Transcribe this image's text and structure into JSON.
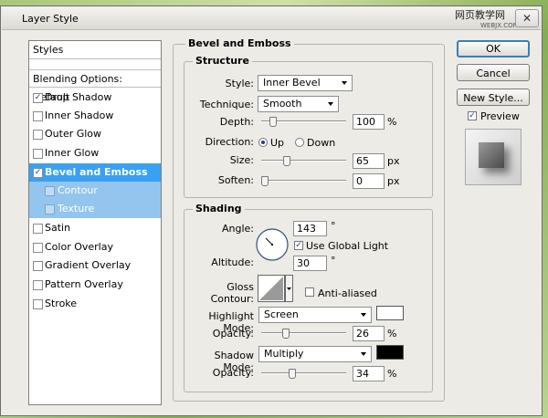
{
  "window": {
    "title": "Layer Style",
    "close_glyph": "✕",
    "watermark": "网页教学网",
    "watermark_url": "WEBJX.COM"
  },
  "styles_list": {
    "header": "Styles",
    "blending": "Blending Options: Default",
    "items": [
      {
        "label": "Drop Shadow",
        "checked": "✓"
      },
      {
        "label": "Inner Shadow",
        "checked": ""
      },
      {
        "label": "Outer Glow",
        "checked": ""
      },
      {
        "label": "Inner Glow",
        "checked": ""
      },
      {
        "label": "Bevel and Emboss",
        "checked": "✓"
      },
      {
        "label": "Contour",
        "checked": ""
      },
      {
        "label": "Texture",
        "checked": ""
      },
      {
        "label": "Satin",
        "checked": ""
      },
      {
        "label": "Color Overlay",
        "checked": ""
      },
      {
        "label": "Gradient Overlay",
        "checked": ""
      },
      {
        "label": "Pattern Overlay",
        "checked": ""
      },
      {
        "label": "Stroke",
        "checked": ""
      }
    ]
  },
  "bevel": {
    "title": "Bevel and Emboss",
    "structure": {
      "title": "Structure",
      "style_label": "Style:",
      "style_value": "Inner Bevel",
      "technique_label": "Technique:",
      "technique_value": "Smooth",
      "depth_label": "Depth:",
      "depth_value": "100",
      "depth_unit": "%",
      "depth_slider": 0.1,
      "direction_label": "Direction:",
      "up_label": "Up",
      "down_label": "Down",
      "direction_selected": "Up",
      "size_label": "Size:",
      "size_value": "65",
      "size_unit": "px",
      "size_slider": 0.27,
      "soften_label": "Soften:",
      "soften_value": "0",
      "soften_unit": "px",
      "soften_slider": 0.0
    },
    "shading": {
      "title": "Shading",
      "angle_label": "Angle:",
      "angle_value": "143",
      "angle_unit": "°",
      "global_light_label": "Use Global Light",
      "global_light_checked": "✓",
      "altitude_label": "Altitude:",
      "altitude_value": "30",
      "altitude_unit": "°",
      "gloss_label": "Gloss Contour:",
      "anti_aliased_label": "Anti-aliased",
      "anti_aliased_checked": "",
      "highlight_label": "Highlight Mode:",
      "highlight_value": "Screen",
      "highlight_color": "#ffffff",
      "hl_opacity_label": "Opacity:",
      "hl_opacity_value": "26",
      "hl_opacity_unit": "%",
      "hl_opacity_slider": 0.26,
      "shadow_label": "Shadow Mode:",
      "shadow_value": "Multiply",
      "shadow_color": "#000000",
      "sh_opacity_label": "Opacity:",
      "sh_opacity_value": "34",
      "sh_opacity_unit": "%",
      "sh_opacity_slider": 0.34
    }
  },
  "buttons": {
    "ok": "OK",
    "cancel": "Cancel",
    "new_style": "New Style...",
    "preview_label": "Preview",
    "preview_checked": "✓"
  }
}
